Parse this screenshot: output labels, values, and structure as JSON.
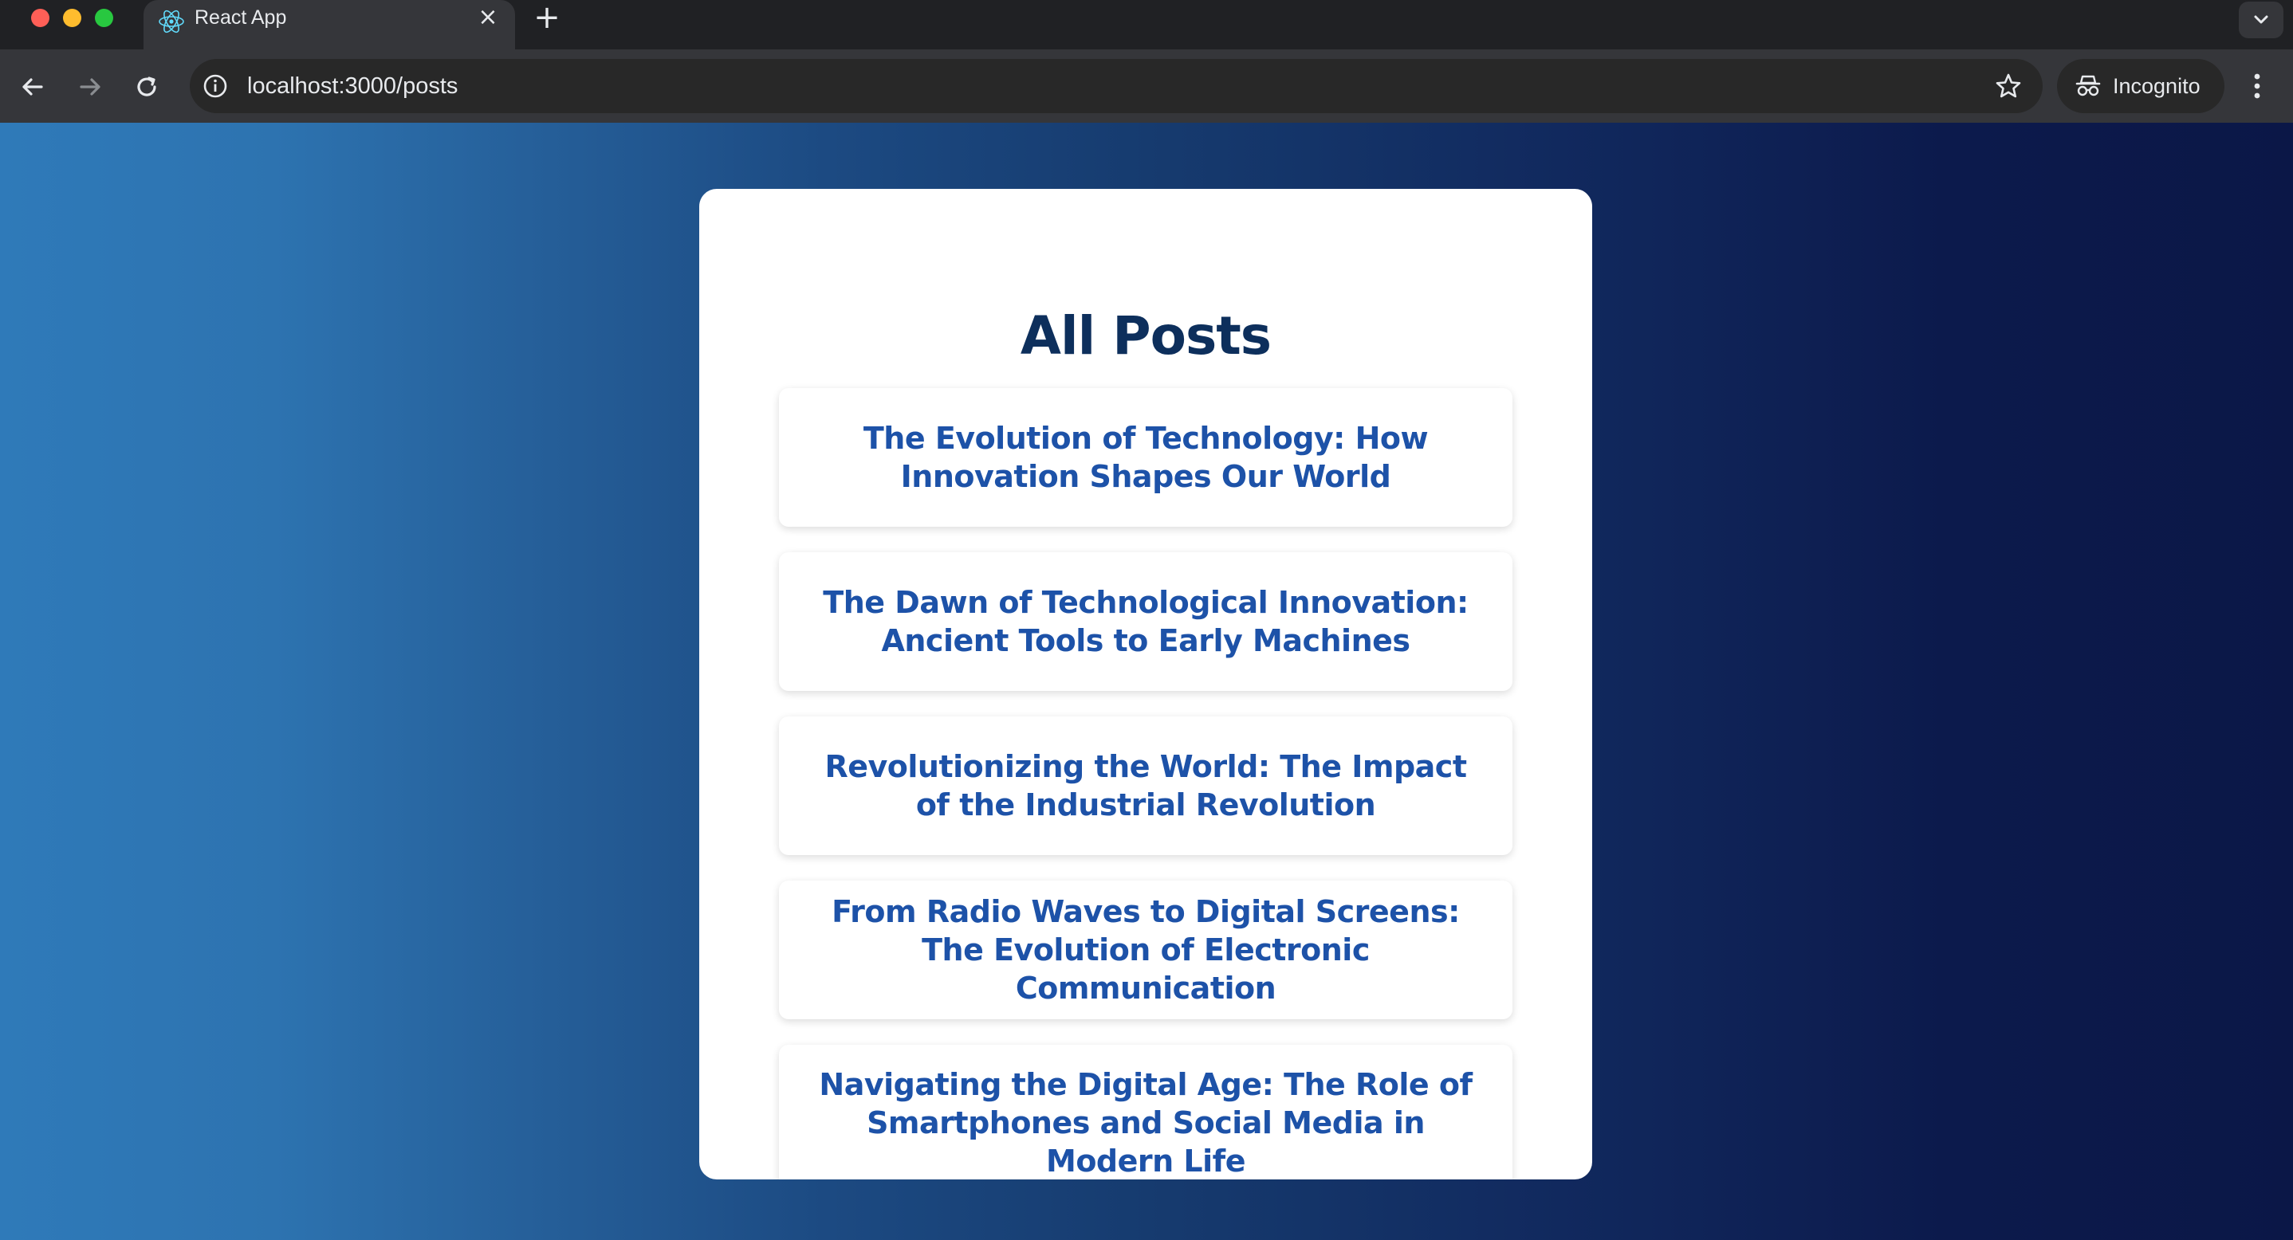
{
  "browser": {
    "tab_title": "React App",
    "tab_close": "×",
    "new_tab": "+",
    "url": "localhost:3000/posts",
    "profile_label": "Incognito",
    "icons": [
      "react-logo-icon",
      "close-icon",
      "plus-icon",
      "chevron-down-icon",
      "back-arrow-icon",
      "forward-arrow-icon",
      "reload-icon",
      "info-icon",
      "star-icon",
      "incognito-icon",
      "more-menu-icon"
    ]
  },
  "page": {
    "title": "All Posts",
    "posts": [
      {
        "title": "The Evolution of Technology: How Innovation Shapes Our World"
      },
      {
        "title": "The Dawn of Technological Innovation: Ancient Tools to Early Machines"
      },
      {
        "title": "Revolutionizing the World: The Impact of the Industrial Revolution"
      },
      {
        "title": "From Radio Waves to Digital Screens: The Evolution of Electronic Communication"
      },
      {
        "title": "Navigating the Digital Age: The Role of Smartphones and Social Media in Modern Life"
      }
    ]
  },
  "colors": {
    "heading": "#0d2f5c",
    "post_link": "#1d52a8",
    "background_start": "#2f7ab9",
    "background_end": "#0b1747",
    "card": "#ffffff"
  }
}
